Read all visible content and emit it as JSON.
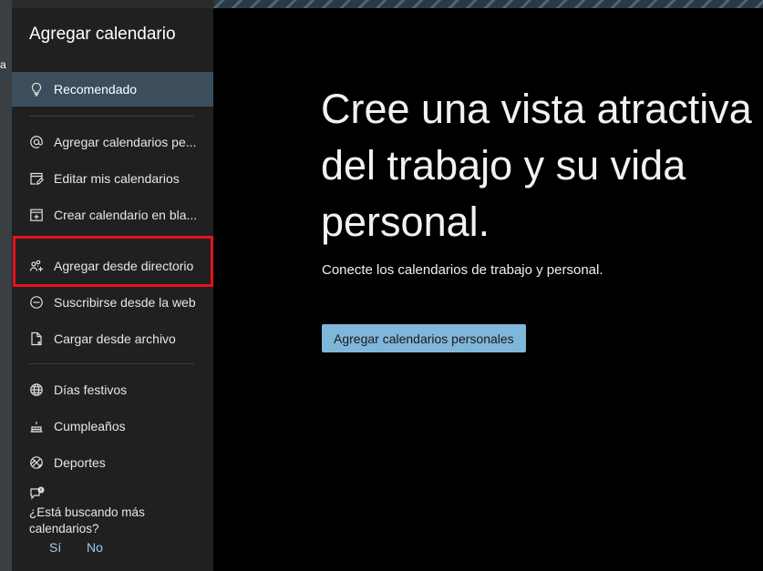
{
  "background": {
    "left_fragment": "a"
  },
  "panel": {
    "title": "Agregar calendario",
    "items": [
      {
        "label": "Recomendado",
        "icon": "lightbulb-icon"
      },
      {
        "label": "Agregar calendarios pe...",
        "icon": "at-sign-icon"
      },
      {
        "label": "Editar mis calendarios",
        "icon": "edit-calendar-icon"
      },
      {
        "label": "Crear calendario en bla...",
        "icon": "new-calendar-icon"
      },
      {
        "label": "Agregar desde directorio",
        "icon": "people-add-icon"
      },
      {
        "label": "Suscribirse desde la web",
        "icon": "web-subscribe-icon"
      },
      {
        "label": "Cargar desde archivo",
        "icon": "file-upload-icon"
      },
      {
        "label": "Días festivos",
        "icon": "globe-icon"
      },
      {
        "label": "Cumpleaños",
        "icon": "cake-icon"
      },
      {
        "label": "Deportes",
        "icon": "sports-ball-icon"
      }
    ],
    "feedback": {
      "icon": "feedback-icon",
      "question": "¿Está buscando más calendarios?",
      "yes": "Sí",
      "no": "No"
    }
  },
  "main": {
    "headline": "Cree una vista atractiva del trabajo y su vida personal.",
    "subtext": "Conecte los calendarios de trabajo y personal.",
    "button_label": "Agregar calendarios personales"
  },
  "colors": {
    "panel_bg": "#202020",
    "active_item_bg": "#3c4e5b",
    "highlight_border": "#e4121b",
    "primary_button": "#7fb6d9",
    "main_bg": "#000000"
  }
}
